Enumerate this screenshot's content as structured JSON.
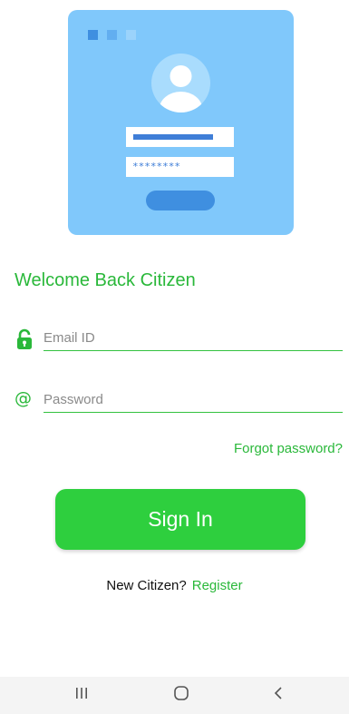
{
  "illustration": {
    "password_mask": "********"
  },
  "login": {
    "welcome_title": "Welcome Back Citizen",
    "email_placeholder": "Email ID",
    "password_placeholder": "Password",
    "password_icon_glyph": "@",
    "forgot_password_label": "Forgot password?",
    "sign_in_label": "Sign In",
    "new_user_prompt": "New Citizen?",
    "register_label": "Register"
  },
  "icons": {
    "email_field_icon": "lock-icon",
    "password_field_icon": "at-sign-icon"
  },
  "system_nav": {
    "buttons": [
      "recent-apps",
      "home",
      "back"
    ]
  },
  "colors": {
    "accent_green": "#2ab83a",
    "button_green": "#2ecf3e",
    "illustration_bg": "#80c8fb",
    "illustration_blue": "#3f8fe0"
  }
}
